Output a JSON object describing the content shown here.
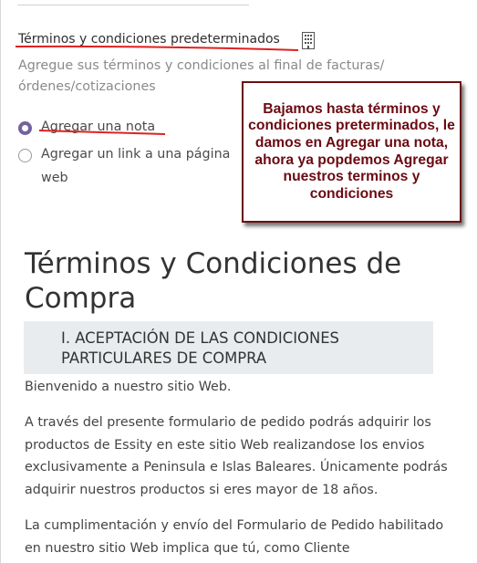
{
  "section": {
    "title": "Términos y condiciones predeterminados",
    "icon": "building-icon",
    "description": "Agregue sus términos y condiciones al final de facturas/ órdenes/cotizaciones"
  },
  "options": {
    "selected": "Agregar una nota",
    "items": [
      {
        "label": "Agregar una nota",
        "checked": true
      },
      {
        "label": "Agregar un link a una página web",
        "checked": false
      }
    ]
  },
  "callout": {
    "text": "Bajamos hasta términos y condiciones preterminados, le damos en Agregar una nota, ahora ya popdemos Agregar nuestros terminos y condiciones",
    "color": "#6b0a12"
  },
  "note": {
    "title": "Términos y Condiciones de Compra",
    "subheading": "I. ACEPTACIÓN DE LAS CONDICIONES PARTICULARES DE COMPRA",
    "paragraphs": [
      "Bienvenido a nuestro sitio Web.",
      "A través del presente formulario de pedido podrás adquirir los productos de Essity en este sitio Web realizandose los envios exclusivamente a Peninsula e Islas Baleares. Únicamente podrás adquirir nuestros productos si eres mayor de 18 años.",
      "La cumplimentación y envío del Formulario de Pedido habilitado en nuestro sitio Web implica que tú, como Cliente"
    ]
  },
  "colors": {
    "accent_radio": "#71639e",
    "annotation_red": "#e02020"
  }
}
